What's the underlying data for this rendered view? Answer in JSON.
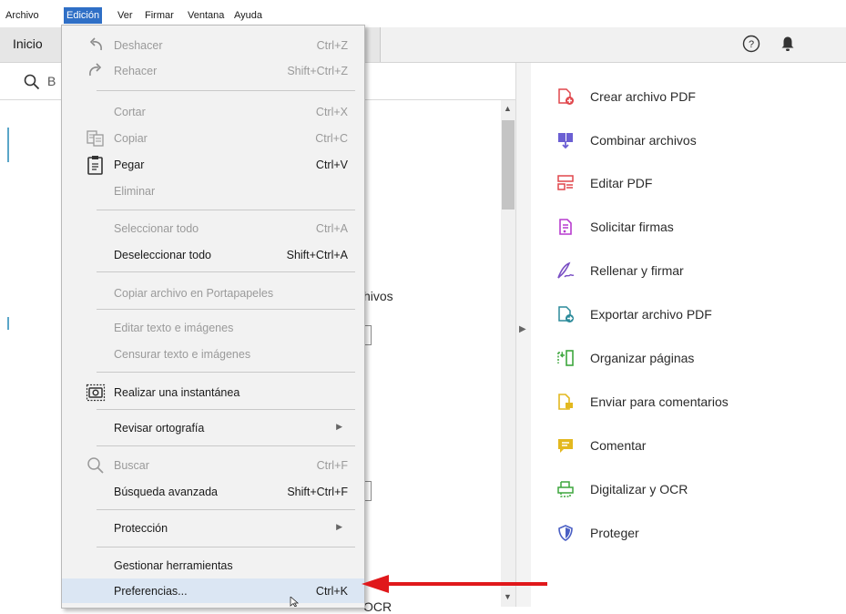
{
  "menubar": {
    "items": [
      "Archivo",
      "Edición",
      "Ver",
      "Firmar",
      "Ventana",
      "Ayuda"
    ],
    "active": "Edición"
  },
  "tabs": {
    "home": "Inicio"
  },
  "search": {
    "value": "B"
  },
  "background": {
    "text1": "hivos",
    "text2": "OCR"
  },
  "edit_menu": {
    "undo": {
      "label": "Deshacer",
      "shortcut": "Ctrl+Z"
    },
    "redo": {
      "label": "Rehacer",
      "shortcut": "Shift+Ctrl+Z"
    },
    "cut": {
      "label": "Cortar",
      "shortcut": "Ctrl+X"
    },
    "copy": {
      "label": "Copiar",
      "shortcut": "Ctrl+C"
    },
    "paste": {
      "label": "Pegar",
      "shortcut": "Ctrl+V"
    },
    "delete": {
      "label": "Eliminar"
    },
    "select_all": {
      "label": "Seleccionar todo",
      "shortcut": "Ctrl+A"
    },
    "deselect_all": {
      "label": "Deseleccionar todo",
      "shortcut": "Shift+Ctrl+A"
    },
    "copy_file": {
      "label": "Copiar archivo en Portapapeles"
    },
    "edit_text": {
      "label": "Editar texto e imágenes"
    },
    "redact_text": {
      "label": "Censurar texto e imágenes"
    },
    "snapshot": {
      "label": "Realizar una instantánea"
    },
    "spelling": {
      "label": "Revisar ortografía"
    },
    "find": {
      "label": "Buscar",
      "shortcut": "Ctrl+F"
    },
    "advanced_search": {
      "label": "Búsqueda avanzada",
      "shortcut": "Shift+Ctrl+F"
    },
    "protection": {
      "label": "Protección"
    },
    "manage_tools": {
      "label": "Gestionar herramientas"
    },
    "preferences": {
      "label": "Preferencias...",
      "shortcut": "Ctrl+K"
    }
  },
  "tools": [
    {
      "label": "Crear archivo PDF",
      "icon": "create-pdf-icon",
      "color": "#e0474c"
    },
    {
      "label": "Combinar archivos",
      "icon": "combine-files-icon",
      "color": "#6b5fd3"
    },
    {
      "label": "Editar PDF",
      "icon": "edit-pdf-icon",
      "color": "#e0474c"
    },
    {
      "label": "Solicitar firmas",
      "icon": "request-signatures-icon",
      "color": "#b73ccf"
    },
    {
      "label": "Rellenar y firmar",
      "icon": "fill-sign-icon",
      "color": "#7a4fc4"
    },
    {
      "label": "Exportar archivo PDF",
      "icon": "export-pdf-icon",
      "color": "#2b8a9a"
    },
    {
      "label": "Organizar páginas",
      "icon": "organize-pages-icon",
      "color": "#3da63d"
    },
    {
      "label": "Enviar para comentarios",
      "icon": "send-comments-icon",
      "color": "#e3b81f"
    },
    {
      "label": "Comentar",
      "icon": "comment-icon",
      "color": "#e3b81f"
    },
    {
      "label": "Digitalizar y OCR",
      "icon": "scan-ocr-icon",
      "color": "#3da63d"
    },
    {
      "label": "Proteger",
      "icon": "protect-icon",
      "color": "#4a5fc4"
    }
  ]
}
